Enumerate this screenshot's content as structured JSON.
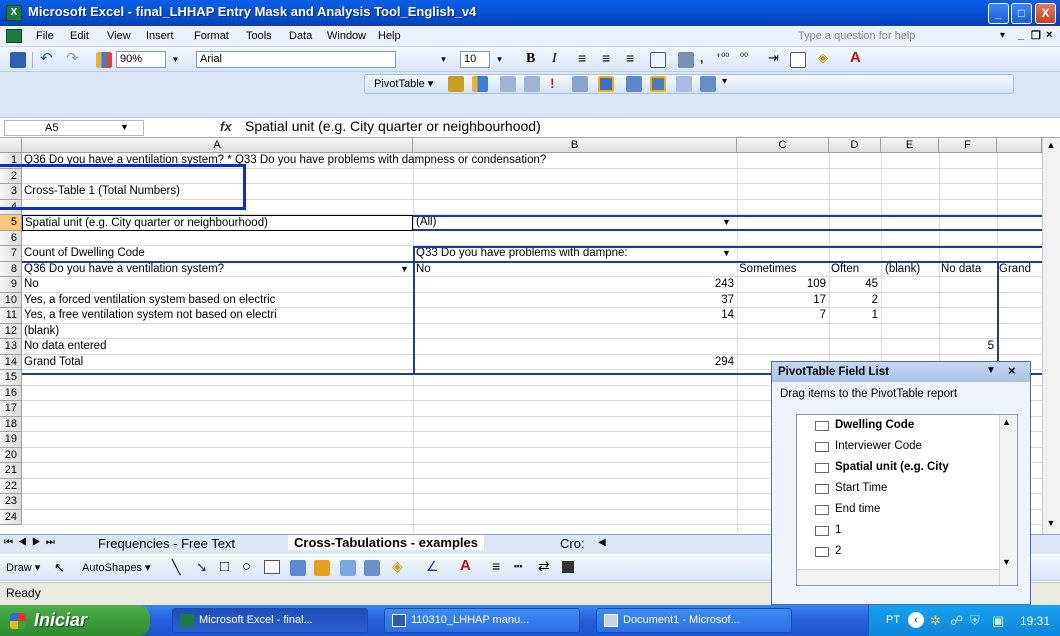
{
  "window": {
    "title": "Microsoft Excel - final_LHHAP Entry Mask and Analysis Tool_English_v4",
    "app_icon": "X",
    "min": "_",
    "max": "□",
    "close": "X"
  },
  "menu": {
    "items": [
      "File",
      "Edit",
      "View",
      "Insert",
      "Format",
      "Tools",
      "Data",
      "Window",
      "Help"
    ],
    "help_placeholder": "Type a question for help"
  },
  "toolbar": {
    "zoom": "90%",
    "font": "Arial",
    "size": "10",
    "bold": "B",
    "italic": "I",
    "pivot_label": "PivotTable ▾"
  },
  "formula_bar": {
    "name_box": "A5",
    "fx": "fx",
    "content": "Spatial unit (e.g. City quarter or neighbourhood)"
  },
  "columns": [
    "A",
    "B",
    "C",
    "D",
    "E",
    "F"
  ],
  "rows": [
    {
      "n": "1",
      "a": "Q36 Do you have a ventilation system? * Q33 Do you have problems with dampness or condensation?"
    },
    {
      "n": "2"
    },
    {
      "n": "3",
      "a": "Cross-Table 1 (Total Numbers)"
    },
    {
      "n": "4"
    },
    {
      "n": "5",
      "a": "Spatial unit (e.g. City quarter or neighbourhood)",
      "b": "(All)"
    },
    {
      "n": "6"
    },
    {
      "n": "7",
      "a": "Count of Dwelling Code",
      "b": "Q33 Do you have problems with dampne:"
    },
    {
      "n": "8",
      "a": "Q36 Do you have a ventilation system?",
      "b": "No",
      "c": "Sometimes",
      "d": "Often",
      "e": "(blank)",
      "f": "No data",
      "g": "Grand"
    },
    {
      "n": "9",
      "a": "No",
      "b": "243",
      "c": "109",
      "d": "45"
    },
    {
      "n": "10",
      "a": "Yes, a forced ventilation system based on electric",
      "b": "37",
      "c": "17",
      "d": "2"
    },
    {
      "n": "11",
      "a": "Yes, a free ventilation system not based on electri",
      "b": "14",
      "c": "7",
      "d": "1"
    },
    {
      "n": "12",
      "a": "(blank)"
    },
    {
      "n": "13",
      "a": "No data entered",
      "f": "5"
    },
    {
      "n": "14",
      "a": "Grand Total",
      "b": "294"
    },
    {
      "n": "15"
    },
    {
      "n": "16"
    },
    {
      "n": "17"
    },
    {
      "n": "18"
    },
    {
      "n": "19"
    },
    {
      "n": "20"
    },
    {
      "n": "21"
    },
    {
      "n": "22"
    },
    {
      "n": "23"
    },
    {
      "n": "24"
    }
  ],
  "sheet_tabs": {
    "tab1": "Frequencies - Free Text",
    "tab2": "Cross-Tabulations - examples",
    "tab3": "Cro:"
  },
  "drawbar": {
    "draw": "Draw ▾",
    "autoshapes": "AutoShapes ▾"
  },
  "status": "Ready",
  "pivot_field_list": {
    "title": "PivotTable Field List",
    "hint": "Drag items to the PivotTable report",
    "fields": [
      {
        "label": "Dwelling Code",
        "bold": true
      },
      {
        "label": "Interviewer Code",
        "bold": false
      },
      {
        "label": "Spatial unit (e.g. City",
        "bold": true
      },
      {
        "label": "Start Time",
        "bold": false
      },
      {
        "label": "End time",
        "bold": false
      },
      {
        "label": "1",
        "bold": false
      },
      {
        "label": "2",
        "bold": false
      }
    ]
  },
  "taskbar": {
    "start": "Iniciar",
    "tasks": [
      "Microsoft Excel - final...",
      "110310_LHHAP manu...",
      "Document1 - Microsof..."
    ],
    "lang": "PT",
    "clock": "19:31"
  },
  "colors": {
    "titlebar": "#0553d6",
    "selection_blue": "#0b2fbf",
    "pivot_border": "#1e3a9a",
    "selected_row": "#ffc978"
  }
}
